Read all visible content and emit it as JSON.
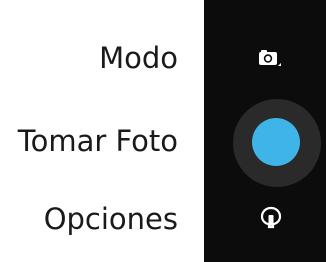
{
  "labels": {
    "mode": "Modo",
    "take_photo": "Tomar Foto",
    "options": "Opciones"
  },
  "camera_panel": {
    "mode_icon": "camera-icon",
    "shutter_color": "#3fb4e8",
    "options_icon": "options-settings-icon",
    "background_color": "#0c0c0c"
  }
}
